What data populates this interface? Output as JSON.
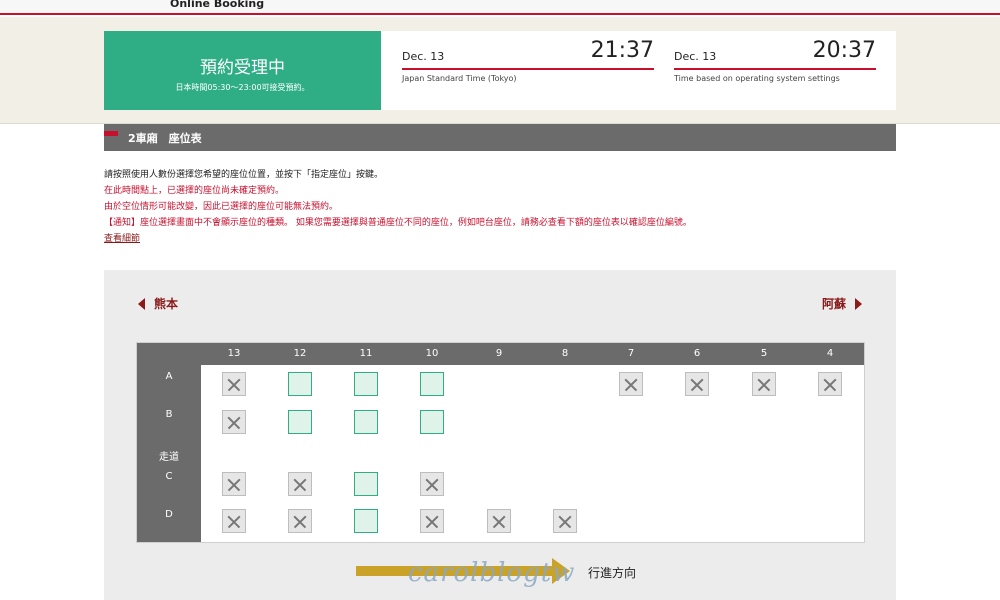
{
  "header": {
    "brand": "Online Booking"
  },
  "status": {
    "title": "預約受理中",
    "hours": "日本時間05:30～23:00可接受預約。"
  },
  "clocks": [
    {
      "date": "Dec. 13",
      "time": "21:37",
      "caption": "Japan Standard Time (Tokyo)"
    },
    {
      "date": "Dec. 13",
      "time": "20:37",
      "caption": "Time based on operating system settings"
    }
  ],
  "car": {
    "title": "2車廂　座位表"
  },
  "notes": {
    "line1": "請按照使用人數份選擇您希望的座位位置，並按下「指定座位」按鍵。",
    "line2": "在此時間點上，已選擇的座位尚未確定預約。",
    "line3": "由於空位情形可能改變，因此已選擇的座位可能無法預約。",
    "line4": "【通知】座位選擇畫面中不會顯示座位的種類。 如果您需要選擇與普通座位不同的座位，例如吧台座位，請務必查看下額的座位表以確認座位編號。",
    "details_link": "查看細節"
  },
  "directions": {
    "left": "熊本",
    "right": "阿蘇"
  },
  "seatmap": {
    "columns": [
      "13",
      "12",
      "11",
      "10",
      "9",
      "8",
      "7",
      "6",
      "5",
      "4"
    ],
    "rows": [
      {
        "label": "A",
        "seats": [
          "taken",
          "available",
          "available",
          "available",
          "none",
          "none",
          "taken",
          "taken",
          "taken",
          "taken"
        ]
      },
      {
        "label": "B",
        "seats": [
          "taken",
          "available",
          "available",
          "available",
          "none",
          "none",
          "none",
          "none",
          "none",
          "none"
        ]
      },
      {
        "label": "走道",
        "seats": []
      },
      {
        "label": "C",
        "seats": [
          "taken",
          "taken",
          "available",
          "taken",
          "none",
          "none",
          "none",
          "none",
          "none",
          "none"
        ]
      },
      {
        "label": "D",
        "seats": [
          "taken",
          "taken",
          "available",
          "taken",
          "taken",
          "taken",
          "none",
          "none",
          "none",
          "none"
        ]
      }
    ]
  },
  "travel": {
    "label": "行進方向"
  },
  "watermark": "carolblogtw",
  "colors": {
    "accent_red": "#c8102e",
    "available_green": "#2fae86",
    "direction_gold": "#c9a227"
  }
}
